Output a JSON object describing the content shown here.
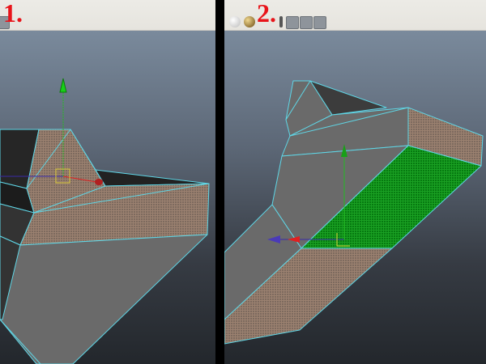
{
  "panels": [
    {
      "label": "1.",
      "toolbar_icons": [
        "share-icon"
      ]
    },
    {
      "label": "2.",
      "toolbar_icons": [
        "smooth-shade-sphere-icon",
        "textured-sphere-icon",
        "lighting-icon",
        "isolate-icon",
        "wireframe-cube-icon",
        "xray-icon",
        "share-icon"
      ]
    }
  ],
  "colors": {
    "wire": "#5fd6e6",
    "selected_face": "#0a8a12",
    "face_gray": "#6a6a6a",
    "dark_face": "#2a2a2a",
    "label": "#e8141a"
  }
}
